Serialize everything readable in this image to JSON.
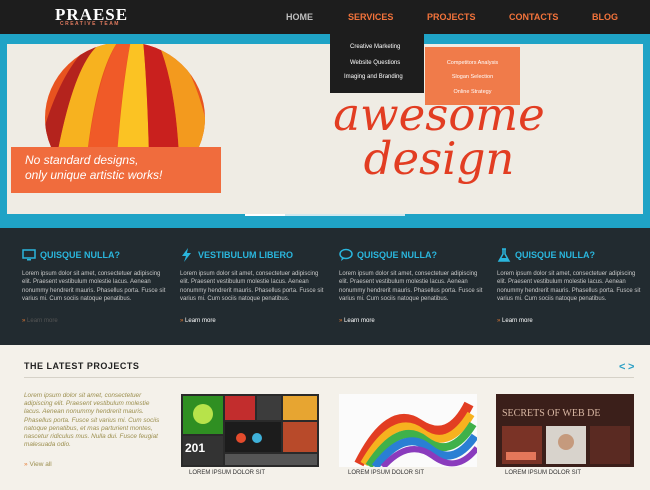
{
  "brand": {
    "name": "PRAESE",
    "tagline": "CREATIVE TEAM"
  },
  "nav": [
    {
      "label": "HOME",
      "color": "#bfbfbf"
    },
    {
      "label": "SERVICES",
      "color": "#f3733b"
    },
    {
      "label": "PROJECTS",
      "color": "#f3733b"
    },
    {
      "label": "CONTACTS",
      "color": "#f3733b"
    },
    {
      "label": "BLOG",
      "color": "#f3733b"
    }
  ],
  "services_menu": [
    "Creative Marketing",
    "Website Questions",
    "Imaging and Branding"
  ],
  "services_submenu": [
    "Competitors Analysis",
    "Slogan Selection",
    "Online Strategy"
  ],
  "hero": {
    "headline_line1": "awesome",
    "headline_line2": "design",
    "slogan_line1": "No standard designs,",
    "slogan_line2": "only unique artistic works!"
  },
  "features": [
    {
      "title": "QUISQUE NULLA?",
      "icon": "monitor-icon",
      "body": "Lorem ipsum dolor sit amet, consectetuer adipiscing elit. Praesent vestibulum molestie lacus. Aenean nonummy hendrerit mauris. Phasellus porta. Fusce sit varius mi. Cum sociis natoque penatibus.",
      "link": "Learn more"
    },
    {
      "title": "VESTIBULUM LIBERO",
      "icon": "lightning-icon",
      "body": "Lorem ipsum dolor sit amet, consectetuer adipiscing elit. Praesent vestibulum molestie lacus. Aenean nonummy hendrerit mauris. Phasellus porta. Fusce sit varius mi. Cum sociis natoque penatibus.",
      "link": "Learn more"
    },
    {
      "title": "QUISQUE NULLA?",
      "icon": "speech-bubble-icon",
      "body": "Lorem ipsum dolor sit amet, consectetuer adipiscing elit. Praesent vestibulum molestie lacus. Aenean nonummy hendrerit mauris. Phasellus porta. Fusce sit varius mi. Cum sociis natoque penatibus.",
      "link": "Learn more"
    },
    {
      "title": "QUISQUE NULLA?",
      "icon": "flask-icon",
      "body": "Lorem ipsum dolor sit amet, consectetuer adipiscing elit. Praesent vestibulum molestie lacus. Aenean nonummy hendrerit mauris. Phasellus porta. Fusce sit varius mi. Cum sociis natoque penatibus.",
      "link": "Learn more"
    }
  ],
  "projects": {
    "title": "THE LATEST PROJECTS",
    "prev": "<",
    "next": ">",
    "description": "Lorem ipsum dolor sit amet, consectetuer adipiscing elit. Praesent vestibulum molestie lacus. Aenean nonummy hendrerit mauris. Phasellus porta. Fusce sit varius mi. Cum sociis natoque penatibus, et mas parturient montes, nascetur ridiculus mus. Nulla dui. Fusce feugiat malesuada odio.",
    "view_all": "View all",
    "items": [
      {
        "caption": "LOREM IPSUM DOLOR SIT",
        "thumb_text": "201"
      },
      {
        "caption": "LOREM IPSUM DOLOR SIT",
        "thumb_text": ""
      },
      {
        "caption": "LOREM IPSUM DOLOR SIT",
        "thumb_text": "SECRETS OF WEB DE"
      }
    ]
  },
  "colors": {
    "accent_orange": "#f3733b",
    "accent_blue": "#2ab6dd",
    "dark": "#1d1d1d",
    "hero_red": "#e23d22"
  }
}
